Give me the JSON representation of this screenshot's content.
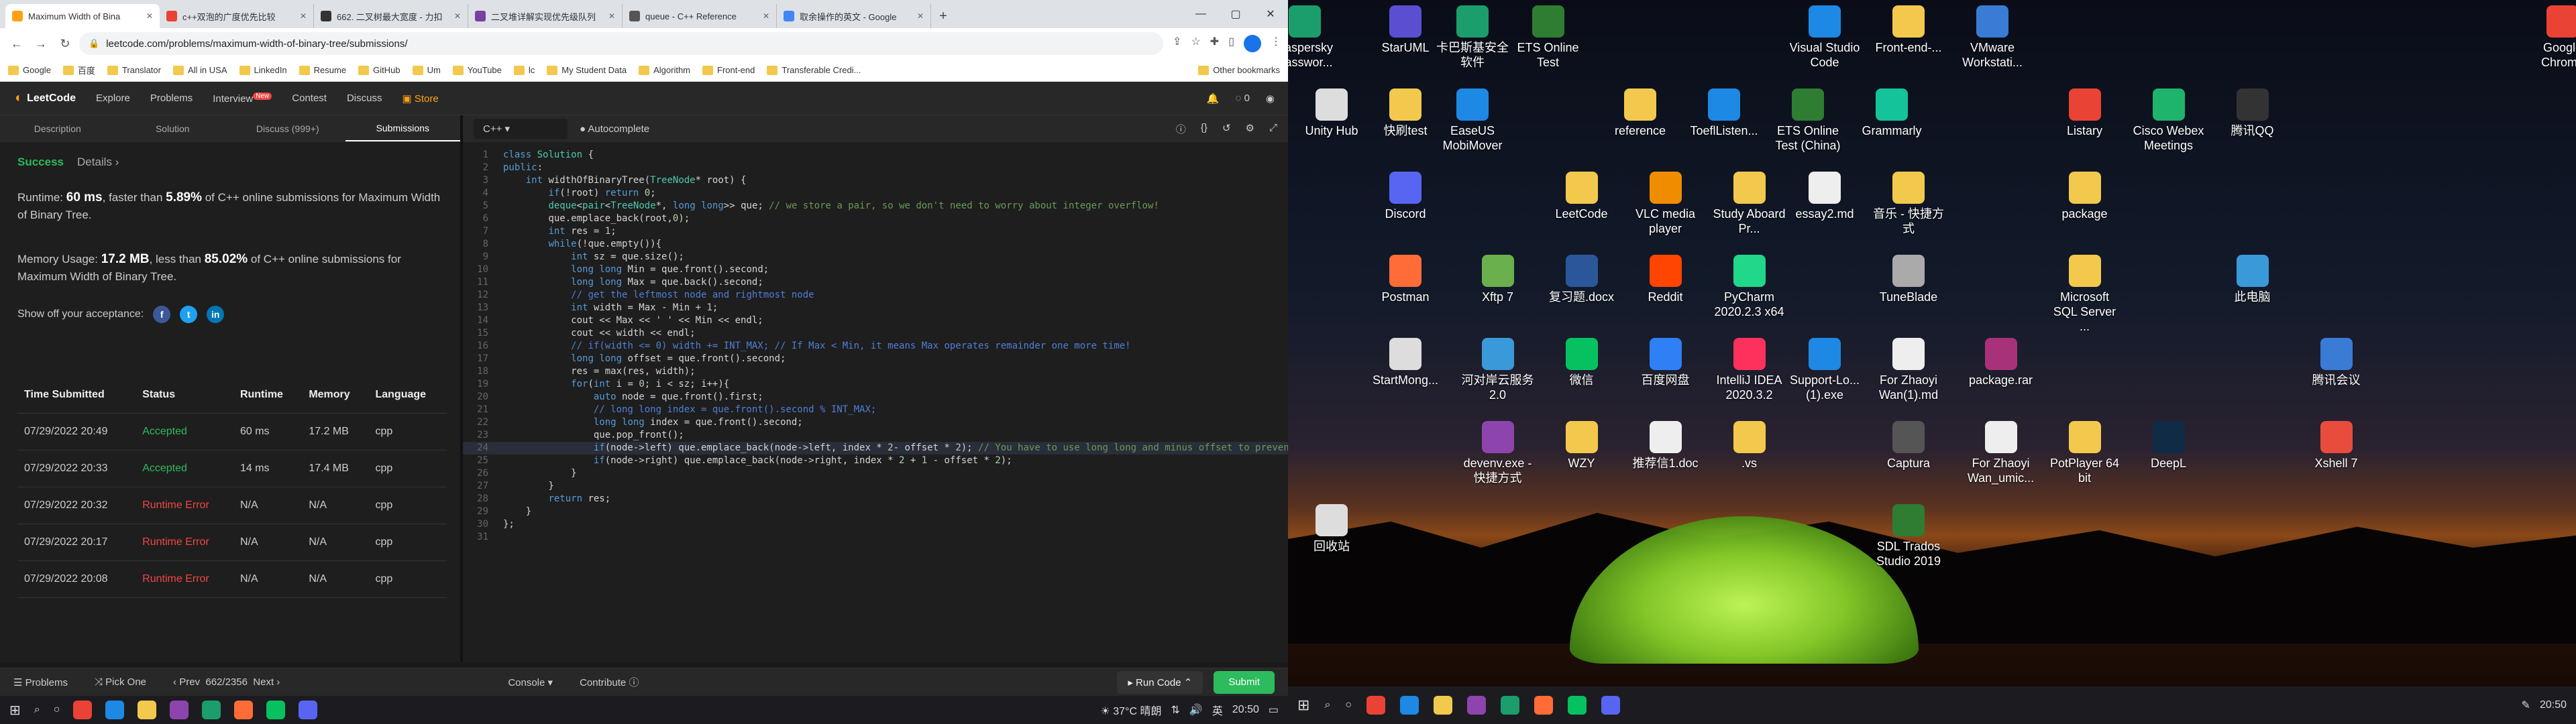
{
  "browser": {
    "tabs": [
      {
        "title": "Maximum Width of Bina",
        "color": "#ffa116",
        "active": true
      },
      {
        "title": "c++双泡的广度优先比较",
        "color": "#e94335"
      },
      {
        "title": "662. 二叉树最大宽度 - 力扣",
        "color": "#333"
      },
      {
        "title": "二叉堆详解实现优先级队列",
        "color": "#7b3fa0"
      },
      {
        "title": "queue - C++ Reference",
        "color": "#555"
      },
      {
        "title": "取余操作的英文 - Google",
        "color": "#4285f4"
      }
    ],
    "url": "leetcode.com/problems/maximum-width-of-binary-tree/submissions/",
    "bookmarks": [
      "Google",
      "百度",
      "Translator",
      "All in USA",
      "LinkedIn",
      "Resume",
      "GitHub",
      "Um",
      "YouTube",
      "lc",
      "My Student Data",
      "Algorithm",
      "Front-end",
      "Transferable Credi..."
    ],
    "other_bookmarks": "Other bookmarks"
  },
  "leetcode": {
    "logo": "LeetCode",
    "nav": [
      "Explore",
      "Problems",
      "Interview",
      "Contest",
      "Discuss"
    ],
    "new_badge": "New",
    "store": "Store",
    "coins": "0",
    "tabs": [
      "Description",
      "Solution",
      "Discuss (999+)",
      "Submissions"
    ],
    "result": {
      "status": "Success",
      "details": "Details"
    },
    "runtime_text": [
      "Runtime: ",
      "60 ms",
      ", faster than ",
      "5.89%",
      " of C++ online submissions for Maximum Width of Binary Tree."
    ],
    "memory_text": [
      "Memory Usage: ",
      "17.2 MB",
      ", less than ",
      "85.02%",
      " of C++ online submissions for Maximum Width of Binary Tree."
    ],
    "share_label": "Show off your acceptance:",
    "table": {
      "headers": [
        "Time Submitted",
        "Status",
        "Runtime",
        "Memory",
        "Language"
      ],
      "rows": [
        [
          "07/29/2022 20:49",
          "Accepted",
          "60 ms",
          "17.2 MB",
          "cpp"
        ],
        [
          "07/29/2022 20:33",
          "Accepted",
          "14 ms",
          "17.4 MB",
          "cpp"
        ],
        [
          "07/29/2022 20:32",
          "Runtime Error",
          "N/A",
          "N/A",
          "cpp"
        ],
        [
          "07/29/2022 20:17",
          "Runtime Error",
          "N/A",
          "N/A",
          "cpp"
        ],
        [
          "07/29/2022 20:08",
          "Runtime Error",
          "N/A",
          "N/A",
          "cpp"
        ]
      ]
    },
    "editor": {
      "language": "C++",
      "autocomplete": "Autocomplete"
    },
    "bottom": {
      "problems": "Problems",
      "pick": "Pick One",
      "prev": "Prev",
      "page": "662/2356",
      "next": "Next",
      "console": "Console",
      "contribute": "Contribute",
      "run": "Run Code",
      "submit": "Submit"
    }
  },
  "code": [
    "class Solution {",
    "public:",
    "    int widthOfBinaryTree(TreeNode* root) {",
    "        if(!root) return 0;",
    "        deque<pair<TreeNode*, long long>> que; // we store a pair, so we don't need to worry about integer overflow!",
    "        que.emplace_back(root,0);",
    "        int res = 1;",
    "        while(!que.empty()){",
    "            int sz = que.size();",
    "            long long Min = que.front().second;",
    "            long long Max = que.back().second;",
    "            // get the leftmost node and rightmost node",
    "            int width = Max - Min + 1;",
    "            cout << Max << ' ' << Min << endl;",
    "            cout << width << endl;",
    "            // if(width <= 0) width += INT_MAX; // If Max < Min, it means Max operates remainder one more time!",
    "            long long offset = que.front().second;",
    "            res = max(res, width);",
    "            for(int i = 0; i < sz; i++){",
    "                auto node = que.front().first;",
    "                // long long index = que.front().second % INT_MAX;",
    "                long long index = que.front().second;",
    "                que.pop_front();",
    "                if(node->left) que.emplace_back(node->left, index * 2- offset * 2); // You have to use long long and minus offset to prevent integer overflow!",
    "                if(node->right) que.emplace_back(node->right, index * 2 + 1 - offset * 2);",
    "            }",
    "        }",
    "        return res;",
    "    }",
    "};",
    ""
  ],
  "left_taskbar": {
    "weather": "37°C 晴朗",
    "lang": "英",
    "time": "20:50"
  },
  "desktop": {
    "icons": [
      {
        "label": "Kaspersky Passwor...",
        "color": "#1b9e6b"
      },
      {
        "label": "StarUML",
        "color": "#5a4fd1"
      },
      {
        "label": "卡巴斯基安全软件",
        "color": "#1b9e6b"
      },
      {
        "label": "ETS Online Test",
        "color": "#2e7d32"
      },
      {
        "label": "Visual Studio Code",
        "color": "#1e88e5"
      },
      {
        "label": "Front-end-...",
        "color": "#f2c94c"
      },
      {
        "label": "VMware Workstati...",
        "color": "#3a7bd5"
      },
      {
        "label": "Google Chrome",
        "color": "#ea4335"
      },
      {
        "label": "Unity Hub",
        "color": "#ddd"
      },
      {
        "label": "快刷test",
        "color": "#f2c94c"
      },
      {
        "label": "EaseUS MobiMover",
        "color": "#1e88e5"
      },
      {
        "label": "reference",
        "color": "#f2c94c"
      },
      {
        "label": "ToeflListen...",
        "color": "#1e88e5"
      },
      {
        "label": "ETS Online Test (China)",
        "color": "#2e7d32"
      },
      {
        "label": "Grammarly",
        "color": "#15c39a"
      },
      {
        "label": "Listary",
        "color": "#e94335"
      },
      {
        "label": "Cisco Webex Meetings",
        "color": "#1fb46b"
      },
      {
        "label": "腾讯QQ",
        "color": "#333"
      },
      {
        "label": "Discord",
        "color": "#5865f2"
      },
      {
        "label": "LeetCode",
        "color": "#f2c94c"
      },
      {
        "label": "VLC media player",
        "color": "#f08c00"
      },
      {
        "label": "Study Aboard Pr...",
        "color": "#f2c94c"
      },
      {
        "label": "essay2.md",
        "color": "#eee"
      },
      {
        "label": "音乐 - 快捷方式",
        "color": "#f2c94c"
      },
      {
        "label": "package",
        "color": "#f2c94c"
      },
      {
        "label": "Postman",
        "color": "#ff6c37"
      },
      {
        "label": "Xftp 7",
        "color": "#6ab04c"
      },
      {
        "label": "复习题.docx",
        "color": "#2b579a"
      },
      {
        "label": "Reddit",
        "color": "#ff4500"
      },
      {
        "label": "PyCharm 2020.2.3 x64",
        "color": "#21d789"
      },
      {
        "label": "TuneBlade",
        "color": "#aaa"
      },
      {
        "label": "Microsoft SQL Server ...",
        "color": "#f2c94c"
      },
      {
        "label": "此电脑",
        "color": "#3a9ad9"
      },
      {
        "label": "StartMong...",
        "color": "#ddd"
      },
      {
        "label": "河对岸云服务2.0",
        "color": "#3a9ad9"
      },
      {
        "label": "微信",
        "color": "#07c160"
      },
      {
        "label": "百度网盘",
        "color": "#2f7ff5"
      },
      {
        "label": "IntelliJ IDEA 2020.3.2",
        "color": "#fe315d"
      },
      {
        "label": "Support-Lo... (1).exe",
        "color": "#1e88e5"
      },
      {
        "label": "For Zhaoyi Wan(1).md",
        "color": "#eee"
      },
      {
        "label": "package.rar",
        "color": "#a83279"
      },
      {
        "label": "腾讯会议",
        "color": "#3a7bd5"
      },
      {
        "label": "devenv.exe - 快捷方式",
        "color": "#8e44ad"
      },
      {
        "label": "WZY",
        "color": "#f2c94c"
      },
      {
        "label": "推荐信1.doc",
        "color": "#eee"
      },
      {
        "label": ".vs",
        "color": "#f2c94c"
      },
      {
        "label": "Captura",
        "color": "#555"
      },
      {
        "label": "For Zhaoyi Wan_umic...",
        "color": "#eee"
      },
      {
        "label": "PotPlayer 64 bit",
        "color": "#f2c94c"
      },
      {
        "label": "DeepL",
        "color": "#0f2b46"
      },
      {
        "label": "Xshell 7",
        "color": "#e74c3c"
      },
      {
        "label": "回收站",
        "color": "#ddd"
      },
      {
        "label": "SDL Trados Studio 2019",
        "color": "#2e7d32"
      }
    ]
  },
  "right_taskbar": {
    "time": "20:50"
  }
}
